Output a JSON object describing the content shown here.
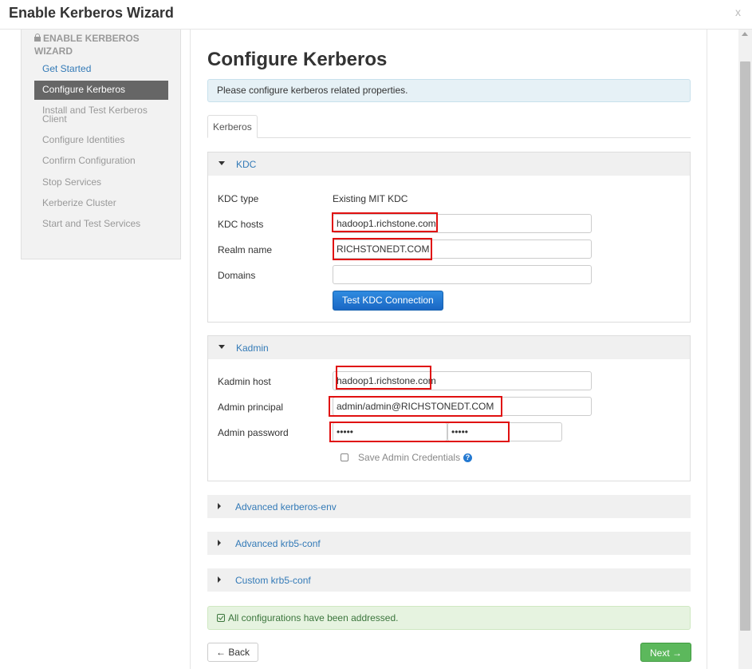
{
  "dialog": {
    "title": "Enable Kerberos Wizard",
    "close": "x"
  },
  "sidebar": {
    "header": "ENABLE KERBEROS WIZARD",
    "steps": [
      {
        "label": "Get Started",
        "state": "link"
      },
      {
        "label": "Configure Kerberos",
        "state": "active"
      },
      {
        "label": "Install and Test Kerberos Client",
        "state": "disabled"
      },
      {
        "label": "Configure Identities",
        "state": "disabled"
      },
      {
        "label": "Confirm Configuration",
        "state": "disabled"
      },
      {
        "label": "Stop Services",
        "state": "disabled"
      },
      {
        "label": "Kerberize Cluster",
        "state": "disabled"
      },
      {
        "label": "Start and Test Services",
        "state": "disabled"
      }
    ]
  },
  "main": {
    "title": "Configure Kerberos",
    "info": "Please configure kerberos related properties.",
    "tab": "Kerberos",
    "kdc": {
      "title": "KDC",
      "type_label": "KDC type",
      "type_value": "Existing MIT KDC",
      "hosts_label": "KDC hosts",
      "hosts_value": "hadoop1.richstone.com",
      "realm_label": "Realm name",
      "realm_value": "RICHSTONEDT.COM",
      "domains_label": "Domains",
      "domains_value": "",
      "test_button": "Test KDC Connection"
    },
    "kadmin": {
      "title": "Kadmin",
      "host_label": "Kadmin host",
      "host_value": "hadoop1.richstone.com",
      "principal_label": "Admin principal",
      "principal_value": "admin/admin@RICHSTONEDT.COM",
      "password_label": "Admin password",
      "password_value": "•••••",
      "password_confirm_value": "•••••",
      "save_creds_label": "Save Admin Credentials",
      "help": "?"
    },
    "collapsed_sections": [
      {
        "title": "Advanced kerberos-env"
      },
      {
        "title": "Advanced krb5-conf"
      },
      {
        "title": "Custom krb5-conf"
      }
    ],
    "success": "All configurations have been addressed.",
    "back_button": "← Back",
    "next_button": "Next →"
  },
  "colors": {
    "link": "#337ab7",
    "active_step": "#666666",
    "primary_button": "#1a67c4",
    "next_button": "#5cb85c",
    "highlight_box": "#e01010"
  }
}
